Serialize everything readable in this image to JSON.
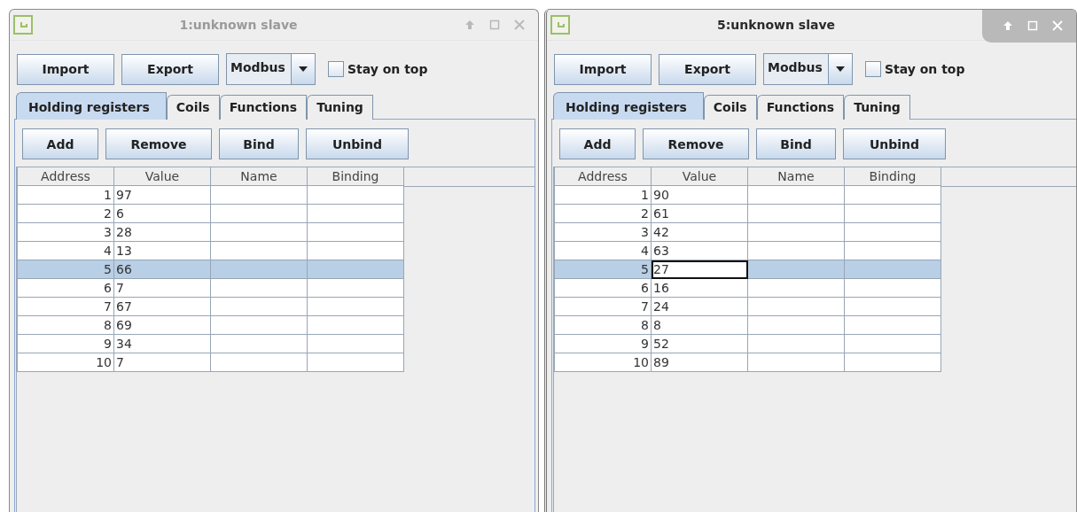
{
  "windows": [
    {
      "title": "1:unknown slave",
      "active": false,
      "toolbar_buttons": [
        "Import",
        "Export"
      ],
      "protocol": "Modbus",
      "stay_on_top": {
        "label": "Stay on top",
        "checked": false
      },
      "tabs": [
        {
          "label": "Holding registers",
          "selected": true
        },
        {
          "label": "Coils",
          "selected": false
        },
        {
          "label": "Functions",
          "selected": false
        },
        {
          "label": "Tuning",
          "selected": false
        }
      ],
      "actions": [
        "Add",
        "Remove",
        "Bind",
        "Unbind"
      ],
      "table": {
        "columns": [
          "Address",
          "Value",
          "Name",
          "Binding"
        ],
        "rows": [
          {
            "address": "1",
            "value": "97",
            "selected": false,
            "focused": false
          },
          {
            "address": "2",
            "value": "6",
            "selected": false,
            "focused": false
          },
          {
            "address": "3",
            "value": "28",
            "selected": false,
            "focused": false
          },
          {
            "address": "4",
            "value": "13",
            "selected": false,
            "focused": false
          },
          {
            "address": "5",
            "value": "66",
            "selected": true,
            "focused": false
          },
          {
            "address": "6",
            "value": "7",
            "selected": false,
            "focused": false
          },
          {
            "address": "7",
            "value": "67",
            "selected": false,
            "focused": false
          },
          {
            "address": "8",
            "value": "69",
            "selected": false,
            "focused": false
          },
          {
            "address": "9",
            "value": "34",
            "selected": false,
            "focused": false
          },
          {
            "address": "10",
            "value": "7",
            "selected": false,
            "focused": false
          }
        ]
      }
    },
    {
      "title": "5:unknown slave",
      "active": true,
      "toolbar_buttons": [
        "Import",
        "Export"
      ],
      "protocol": "Modbus",
      "stay_on_top": {
        "label": "Stay on top",
        "checked": false
      },
      "tabs": [
        {
          "label": "Holding registers",
          "selected": true
        },
        {
          "label": "Coils",
          "selected": false
        },
        {
          "label": "Functions",
          "selected": false
        },
        {
          "label": "Tuning",
          "selected": false
        }
      ],
      "actions": [
        "Add",
        "Remove",
        "Bind",
        "Unbind"
      ],
      "table": {
        "columns": [
          "Address",
          "Value",
          "Name",
          "Binding"
        ],
        "rows": [
          {
            "address": "1",
            "value": "90",
            "selected": false,
            "focused": false
          },
          {
            "address": "2",
            "value": "61",
            "selected": false,
            "focused": false
          },
          {
            "address": "3",
            "value": "42",
            "selected": false,
            "focused": false
          },
          {
            "address": "4",
            "value": "63",
            "selected": false,
            "focused": false
          },
          {
            "address": "5",
            "value": "27",
            "selected": true,
            "focused": true
          },
          {
            "address": "6",
            "value": "16",
            "selected": false,
            "focused": false
          },
          {
            "address": "7",
            "value": "24",
            "selected": false,
            "focused": false
          },
          {
            "address": "8",
            "value": "8",
            "selected": false,
            "focused": false
          },
          {
            "address": "9",
            "value": "52",
            "selected": false,
            "focused": false
          },
          {
            "address": "10",
            "value": "89",
            "selected": false,
            "focused": false
          }
        ]
      }
    }
  ]
}
